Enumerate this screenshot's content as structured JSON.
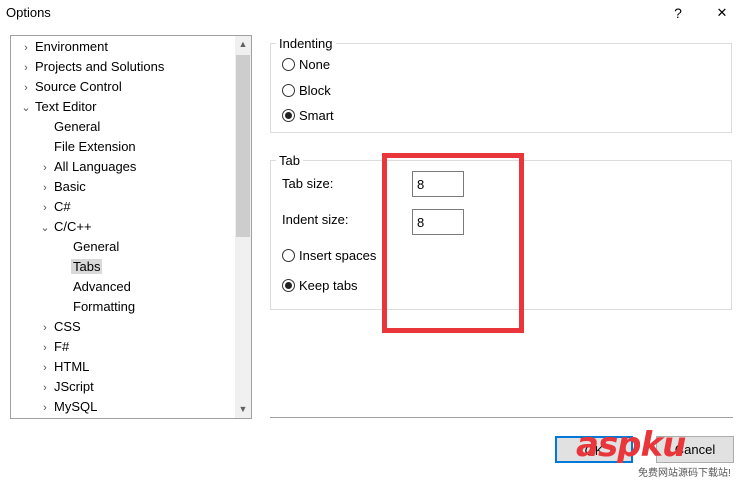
{
  "window": {
    "title": "Options",
    "help_label": "?",
    "close_label": "✕"
  },
  "tree": {
    "items": [
      {
        "label": "Environment",
        "arrow": "›",
        "depth": 0
      },
      {
        "label": "Projects and Solutions",
        "arrow": "›",
        "depth": 0
      },
      {
        "label": "Source Control",
        "arrow": "›",
        "depth": 0
      },
      {
        "label": "Text Editor",
        "arrow": "⌄",
        "depth": 0
      },
      {
        "label": "General",
        "arrow": "",
        "depth": 1
      },
      {
        "label": "File Extension",
        "arrow": "",
        "depth": 1
      },
      {
        "label": "All Languages",
        "arrow": "›",
        "depth": 1
      },
      {
        "label": "Basic",
        "arrow": "›",
        "depth": 1
      },
      {
        "label": "C#",
        "arrow": "›",
        "depth": 1
      },
      {
        "label": "C/C++",
        "arrow": "⌄",
        "depth": 1
      },
      {
        "label": "General",
        "arrow": "",
        "depth": 2
      },
      {
        "label": "Tabs",
        "arrow": "",
        "depth": 2,
        "selected": true
      },
      {
        "label": "Advanced",
        "arrow": "",
        "depth": 2
      },
      {
        "label": "Formatting",
        "arrow": "",
        "depth": 2
      },
      {
        "label": "CSS",
        "arrow": "›",
        "depth": 1
      },
      {
        "label": "F#",
        "arrow": "›",
        "depth": 1
      },
      {
        "label": "HTML",
        "arrow": "›",
        "depth": 1
      },
      {
        "label": "JScript",
        "arrow": "›",
        "depth": 1
      },
      {
        "label": "MySQL",
        "arrow": "›",
        "depth": 1
      }
    ],
    "scroll_up": "▲",
    "scroll_down": "▼"
  },
  "indenting": {
    "title": "Indenting",
    "options": [
      "None",
      "Block",
      "Smart"
    ],
    "selected": "Smart"
  },
  "tab": {
    "title": "Tab",
    "tab_size_label": "Tab size:",
    "tab_size_value": "8",
    "indent_size_label": "Indent size:",
    "indent_size_value": "8",
    "insert_spaces_label": "Insert spaces",
    "keep_tabs_label": "Keep tabs",
    "selected": "Keep tabs"
  },
  "buttons": {
    "ok": "OK",
    "cancel": "Cancel"
  },
  "watermark": {
    "brand": "aspku",
    "sub": "免费网站源码下载站!"
  },
  "colors": {
    "highlight_box": "#e8363b",
    "selection": "#d9d9d9",
    "default_button_border": "#0078d7"
  }
}
